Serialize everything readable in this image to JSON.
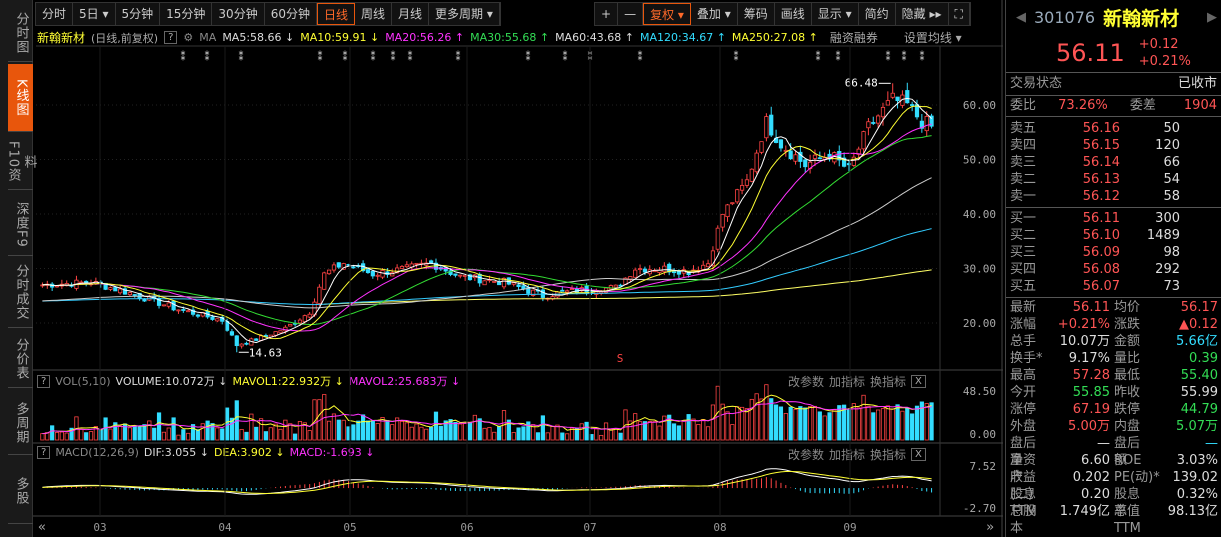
{
  "sidebar": [
    {
      "label": "分时图"
    },
    {
      "label": "K线图",
      "active": true
    },
    {
      "label": "F10资料"
    },
    {
      "label": "深度F9"
    },
    {
      "label": "分时成交"
    },
    {
      "label": "分价表"
    },
    {
      "label": "多周期"
    },
    {
      "label": "多股"
    }
  ],
  "periods": [
    "分时",
    "5日 ▾",
    "5分钟",
    "15分钟",
    "30分钟",
    "60分钟",
    "日线",
    "周线",
    "月线",
    "更多周期 ▾"
  ],
  "active_period": "日线",
  "tools": [
    "+",
    "—",
    "复权 ▾",
    "叠加 ▾",
    "筹码",
    "画线",
    "显示 ▾",
    "简约",
    "隐藏 ▸▸",
    "⛶"
  ],
  "legend": {
    "name": "新翰新材",
    "mode": "(日线,前复权)",
    "help": "?",
    "ma": "MA",
    "ma5": "MA5:58.66 ↓",
    "ma10": "MA10:59.91 ↓",
    "ma20": "MA20:56.26 ↑",
    "ma30": "MA30:55.68 ↑",
    "ma60": "MA60:43.68 ↑",
    "ma120": "MA120:34.67 ↑",
    "ma250": "MA250:27.08 ↑",
    "margin": "融资融券",
    "setma": "设置均线 ▾"
  },
  "price_axis": [
    "60.00",
    "50.00",
    "40.00",
    "30.00",
    "20.00"
  ],
  "annotations": {
    "high": "66.48",
    "low": "14.63",
    "marker": "S"
  },
  "vol_panel": {
    "help": "?",
    "name": "VOL(5,10)",
    "volume": "VOLUME:10.072万 ↓",
    "mavol1": "MAVOL1:22.932万 ↓",
    "mavol2": "MAVOL2:25.683万 ↓",
    "axis": [
      "48.50",
      "0.00"
    ]
  },
  "macd_panel": {
    "help": "?",
    "name": "MACD(12,26,9)",
    "dif": "DIF:3.055 ↓",
    "dea": "DEA:3.902 ↓",
    "macd": "MACD:-1.693 ↓",
    "axis": [
      "7.52",
      "-2.70"
    ]
  },
  "panel_actions": [
    "改参数",
    "加指标",
    "换指标",
    "X"
  ],
  "months": [
    "03",
    "04",
    "05",
    "06",
    "07",
    "08",
    "09"
  ],
  "nav": {
    "prev": "«",
    "next": "»"
  },
  "quote": {
    "code": "301076",
    "name": "新翰新材",
    "price": "56.11",
    "change": "+0.12",
    "pct": "+0.21%",
    "status_label": "交易状态",
    "status": "已收市",
    "wb_label": "委比",
    "wb": "73.26%",
    "wc_label": "委差",
    "wc": "1904"
  },
  "asks": [
    {
      "l": "卖五",
      "p": "56.16",
      "v": "50"
    },
    {
      "l": "卖四",
      "p": "56.15",
      "v": "120"
    },
    {
      "l": "卖三",
      "p": "56.14",
      "v": "66"
    },
    {
      "l": "卖二",
      "p": "56.13",
      "v": "54"
    },
    {
      "l": "卖一",
      "p": "56.12",
      "v": "58"
    }
  ],
  "bids": [
    {
      "l": "买一",
      "p": "56.11",
      "v": "300"
    },
    {
      "l": "买二",
      "p": "56.10",
      "v": "1489"
    },
    {
      "l": "买三",
      "p": "56.09",
      "v": "98"
    },
    {
      "l": "买四",
      "p": "56.08",
      "v": "292"
    },
    {
      "l": "买五",
      "p": "56.07",
      "v": "73"
    }
  ],
  "stats": [
    [
      "最新",
      "56.11",
      "red",
      "均价",
      "56.17",
      "red"
    ],
    [
      "涨幅",
      "+0.21%",
      "red",
      "涨跌",
      "▲0.12",
      "red"
    ],
    [
      "总手",
      "10.07万",
      "wh",
      "金额",
      "5.66亿",
      "cy"
    ],
    [
      "换手*",
      "9.17%",
      "wh",
      "量比",
      "0.39",
      "grn"
    ],
    [
      "最高",
      "57.28",
      "red",
      "最低",
      "55.40",
      "grn"
    ],
    [
      "今开",
      "55.85",
      "grn",
      "昨收",
      "55.99",
      "wh"
    ],
    [
      "涨停",
      "67.19",
      "red",
      "跌停",
      "44.79",
      "grn"
    ],
    [
      "外盘",
      "5.00万",
      "red",
      "内盘",
      "5.07万",
      "grn"
    ],
    [
      "盘后量",
      "—",
      "wh",
      "盘后额",
      "—",
      "cy"
    ],
    [
      "净资产",
      "6.60",
      "wh",
      "ROE",
      "3.03%",
      "wh"
    ],
    [
      "收益(二)",
      "0.202",
      "wh",
      "PE(动)*",
      "139.02",
      "wh"
    ],
    [
      "股息TTM",
      "0.20",
      "wh",
      "股息率TTM",
      "0.32%",
      "wh"
    ],
    [
      "总股本",
      "1.749亿",
      "wh",
      "总值",
      "98.13亿",
      "wh"
    ]
  ],
  "chart_data": {
    "type": "candlestick",
    "ylim": [
      14,
      68
    ],
    "keypoints": [
      [
        0,
        27
      ],
      [
        10,
        27.5
      ],
      [
        18,
        25.5
      ],
      [
        28,
        22.5
      ],
      [
        37,
        20.5
      ],
      [
        40,
        16
      ],
      [
        44,
        17
      ],
      [
        50,
        19
      ],
      [
        55,
        22
      ],
      [
        58,
        29
      ],
      [
        62,
        31
      ],
      [
        68,
        29
      ],
      [
        75,
        30
      ],
      [
        80,
        31
      ],
      [
        86,
        28.5
      ],
      [
        95,
        27.5
      ],
      [
        103,
        25
      ],
      [
        110,
        26
      ],
      [
        118,
        26.5
      ],
      [
        122,
        30
      ],
      [
        128,
        30
      ],
      [
        133,
        29.5
      ],
      [
        137,
        31
      ],
      [
        140,
        40
      ],
      [
        145,
        46
      ],
      [
        149,
        57
      ],
      [
        152,
        53
      ],
      [
        157,
        49
      ],
      [
        162,
        51
      ],
      [
        166,
        48
      ],
      [
        170,
        56
      ],
      [
        175,
        61
      ],
      [
        178,
        60
      ],
      [
        181,
        57
      ],
      [
        183,
        56.11
      ]
    ]
  }
}
